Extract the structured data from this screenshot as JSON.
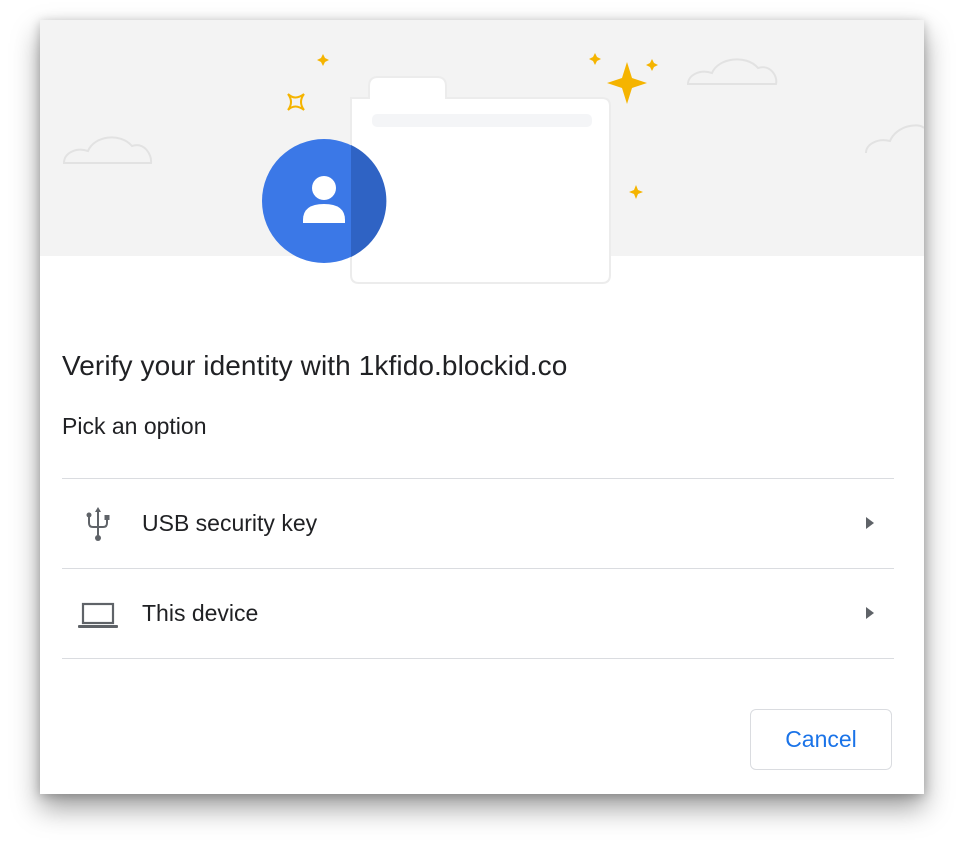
{
  "dialog": {
    "title": "Verify your identity with 1kfido.blockid.co",
    "subtitle": "Pick an option",
    "options": [
      {
        "label": "USB security key",
        "icon": "usb-icon"
      },
      {
        "label": "This device",
        "icon": "laptop-icon"
      }
    ],
    "cancel_label": "Cancel"
  },
  "colors": {
    "accent": "#1a73e8",
    "avatar": "#3b78e7",
    "sparkle": "#f5b400",
    "header_bg": "#f3f3f3"
  }
}
